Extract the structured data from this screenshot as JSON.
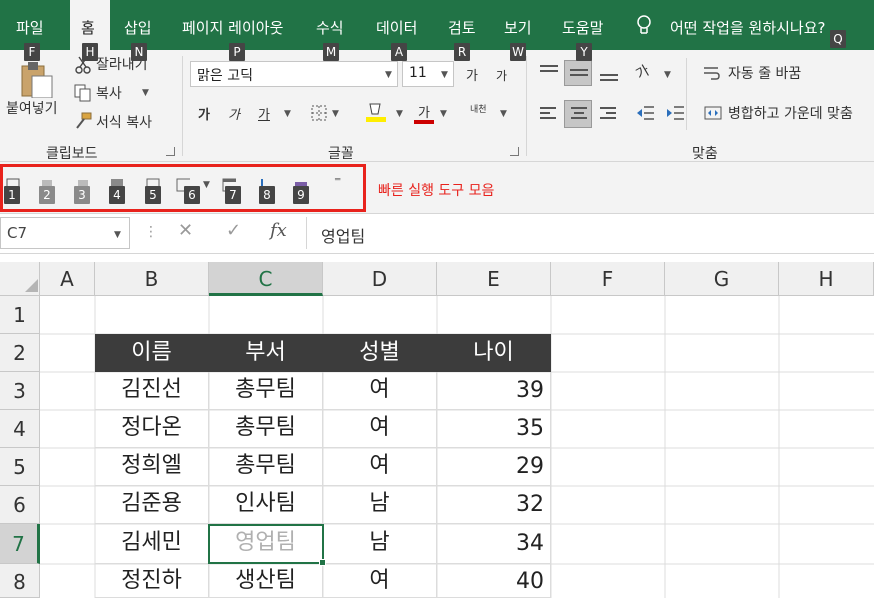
{
  "menubar": {
    "tabs": [
      {
        "label": "파일",
        "key": "F"
      },
      {
        "label": "홈",
        "key": "H"
      },
      {
        "label": "삽입",
        "key": "N"
      },
      {
        "label": "페이지 레이아웃",
        "key": "P"
      },
      {
        "label": "수식",
        "key": "M"
      },
      {
        "label": "데이터",
        "key": "A"
      },
      {
        "label": "검토",
        "key": "R"
      },
      {
        "label": "보기",
        "key": "W"
      },
      {
        "label": "도움말",
        "key": "Y"
      }
    ],
    "tell_me": "어떤 작업을 원하시나요?",
    "tell_me_key": "Q",
    "active_tab": "홈"
  },
  "ribbon": {
    "clipboard": {
      "paste": "붙여넣기",
      "cut": "잘라내기",
      "copy": "복사",
      "format_painter": "서식 복사",
      "group_label": "클립보드"
    },
    "font": {
      "font_name": "맑은 고딕",
      "font_size": "11",
      "grow": "가",
      "shrink": "가",
      "bold": "가",
      "italic": "가",
      "underline": "가",
      "font_color": "가",
      "phonetic": "내천",
      "group_label": "글꼴"
    },
    "alignment": {
      "wrap_text": "자동 줄 바꿈",
      "merge_center": "병합하고 가운데 맞춤",
      "group_label": "맞춤"
    }
  },
  "qat": {
    "keys": [
      "1",
      "2",
      "3",
      "4",
      "5",
      "6",
      "7",
      "8",
      "9"
    ],
    "label": "빠른 실행 도구 모음"
  },
  "formula_bar": {
    "name_box": "C7",
    "fx": "fx",
    "value": "영업팀"
  },
  "sheet": {
    "columns": [
      "A",
      "B",
      "C",
      "D",
      "E",
      "F",
      "G",
      "H"
    ],
    "rows": [
      "1",
      "2",
      "3",
      "4",
      "5",
      "6",
      "7",
      "8"
    ],
    "selected_column": "C",
    "selected_row": "7",
    "table_headers": [
      "이름",
      "부서",
      "성별",
      "나이"
    ],
    "table_rows": [
      [
        "김진선",
        "총무팀",
        "여",
        "39"
      ],
      [
        "정다온",
        "총무팀",
        "여",
        "35"
      ],
      [
        "정희엘",
        "총무팀",
        "여",
        "29"
      ],
      [
        "김준용",
        "인사팀",
        "남",
        "32"
      ],
      [
        "김세민",
        "영업팀",
        "남",
        "34"
      ],
      [
        "정진하",
        "생산팀",
        "여",
        "40"
      ]
    ]
  },
  "colors": {
    "accent": "#217346",
    "highlight": "#e8221c",
    "header_fill": "#3c3c3c"
  }
}
